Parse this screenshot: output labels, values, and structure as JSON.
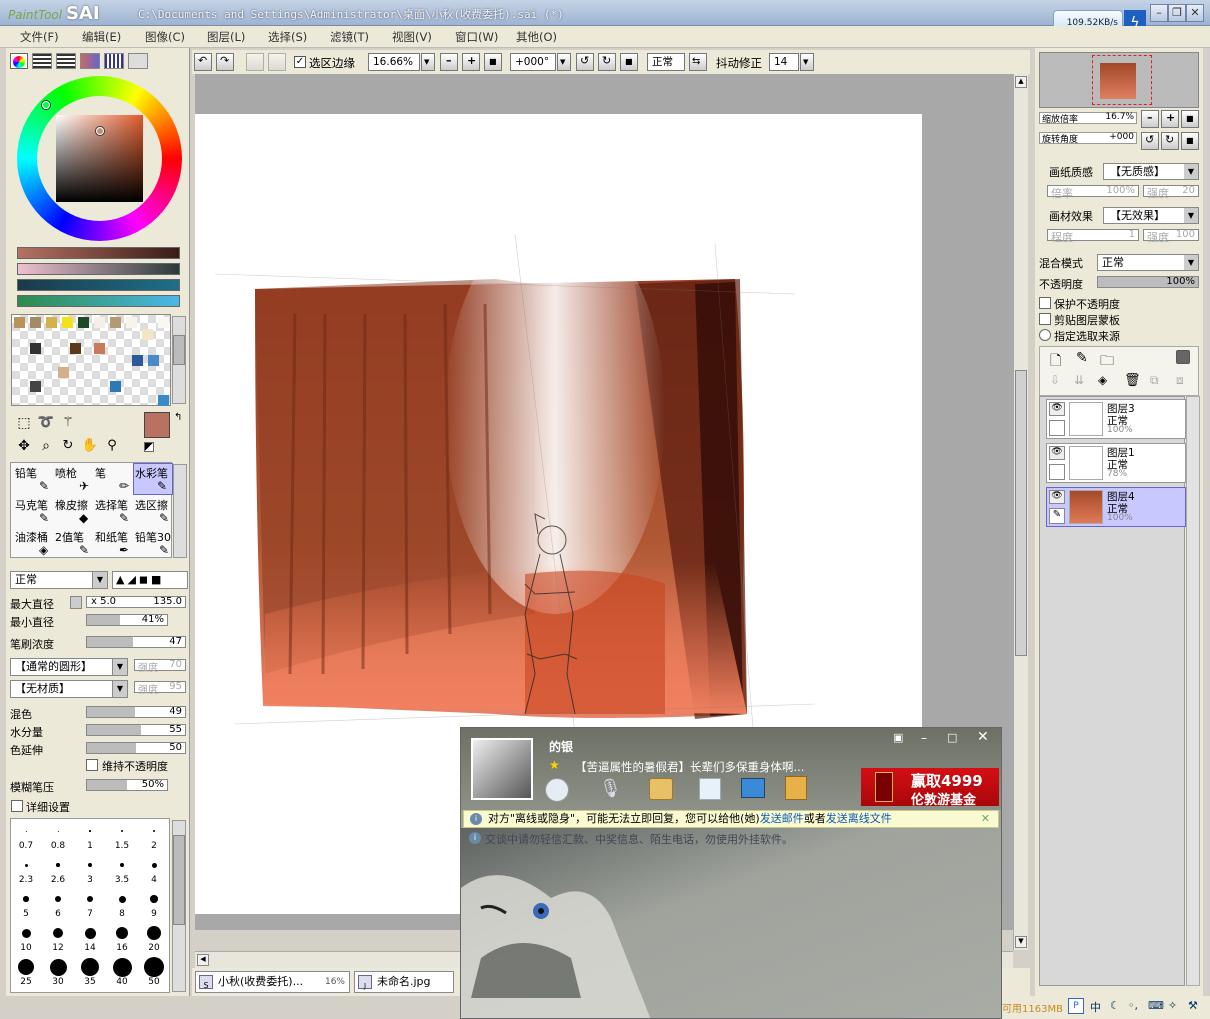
{
  "app": {
    "logo_small": "PaintTool",
    "logo_big": "SAI",
    "path": "C:\\Documents and Settings\\Administrator\\桌面\\小秋(收费委托).sai (*)",
    "net_speed": "109.52KB/s"
  },
  "menu": [
    "文件(F)",
    "编辑(E)",
    "图像(C)",
    "图层(L)",
    "选择(S)",
    "滤镜(T)",
    "视图(V)",
    "窗口(W)",
    "其他(O)"
  ],
  "toolbar": {
    "selection_edge_label": "选区边缘",
    "zoom": "16.66%",
    "rotation": "+000°",
    "blend": "正常",
    "stabilizer_label": "抖动修正",
    "stabilizer_value": "14"
  },
  "tools": {
    "row1": [
      "铅笔",
      "喷枪",
      "笔",
      "水彩笔"
    ],
    "row2": [
      "马克笔",
      "橡皮擦",
      "选择笔",
      "选区擦"
    ],
    "row3": [
      "油漆桶",
      "2值笔",
      "和纸笔",
      "铅笔30"
    ]
  },
  "brush": {
    "mode": "正常",
    "max_diameter_label": "最大直径",
    "max_diameter_mult": "x 5.0",
    "max_diameter_value": "135.0",
    "min_diameter_label": "最小直径",
    "min_diameter_value": "41%",
    "min_diameter_fraction": 0.41,
    "density_label": "笔刷浓度",
    "density_value": "47",
    "shape": "【通常的圆形】",
    "shape_strength_label": "强度",
    "shape_strength": "70",
    "texture": "【无材质】",
    "texture_strength_label": "强度",
    "texture_strength": "95",
    "mix_label": "混色",
    "mix_value": "49",
    "water_label": "水分量",
    "water_value": "55",
    "extend_label": "色延伸",
    "extend_value": "50",
    "keep_opacity_label": "维持不透明度",
    "blur_label": "模糊笔压",
    "blur_value": "50%",
    "detail_label": "详细设置"
  },
  "brush_sizes": [
    "0.7",
    "0.8",
    "1",
    "1.5",
    "2",
    "2.3",
    "2.6",
    "3",
    "3.5",
    "4",
    "5",
    "6",
    "7",
    "8",
    "9",
    "10",
    "12",
    "14",
    "16",
    "20",
    "25",
    "30",
    "35",
    "40",
    "50"
  ],
  "navigator": {
    "zoom_label": "缩放倍率",
    "zoom_value": "16.7%",
    "rotate_label": "旋转角度",
    "rotate_value": "+000"
  },
  "paper": {
    "texture_label": "画纸质感",
    "texture_value": "【无质感】",
    "scale_label": "倍率",
    "scale_value": "100%",
    "strength_label": "强度",
    "strength_value": "20",
    "effect_label": "画材效果",
    "effect_value": "【无效果】",
    "degree_label": "程度",
    "degree_value": "1",
    "effect_strength_label": "强度",
    "effect_strength_value": "100"
  },
  "layer_props": {
    "blend_label": "混合模式",
    "blend_value": "正常",
    "opacity_label": "不透明度",
    "opacity_value": "100%",
    "protect_label": "保护不透明度",
    "clip_label": "剪贴图层蒙板",
    "source_label": "指定选取来源"
  },
  "layers": [
    {
      "name": "图层3",
      "mode": "正常",
      "opacity": "100%"
    },
    {
      "name": "图层1",
      "mode": "正常",
      "opacity": "78%"
    },
    {
      "name": "图层4",
      "mode": "正常",
      "opacity": "100%"
    }
  ],
  "tabs": [
    {
      "label": "小秋(收费委托)...",
      "zoom": "16%"
    },
    {
      "label": "未命名.jpg"
    }
  ],
  "chat": {
    "name": "的银",
    "status": "【苦逼属性的暑假君】长辈们多保重身体啊...",
    "ad_line1": "赢取4999",
    "ad_line2": "伦敦游基金",
    "notice_pre": "对方\"离线或隐身\"，可能无法立即回复，您可以给他(她)",
    "notice_link1": "发送邮件",
    "notice_mid": "或者",
    "notice_link2": "发送离线文件",
    "warning": "交谈中请勿轻信汇款、中奖信息、陌生电话，勿使用外挂软件。"
  },
  "taskbar": {
    "memory": "可用1163MB",
    "ime": "中"
  },
  "colors": {
    "primary": "#b97262",
    "accent": "#3366cc"
  }
}
